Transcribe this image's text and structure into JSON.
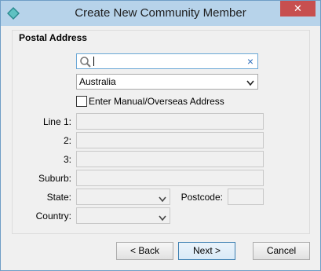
{
  "window": {
    "title": "Create New Community Member"
  },
  "group": {
    "title": "Postal Address"
  },
  "search": {
    "value": "",
    "placeholder": ""
  },
  "country_select": {
    "value": "Australia"
  },
  "manual_address": {
    "label": "Enter Manual/Overseas Address",
    "checked": false
  },
  "labels": {
    "line1": "Line 1:",
    "line2": "2:",
    "line3": "3:",
    "suburb": "Suburb:",
    "state": "State:",
    "postcode": "Postcode:",
    "country": "Country:"
  },
  "buttons": {
    "back": "< Back",
    "next": "Next >",
    "cancel": "Cancel"
  },
  "icons": [
    "app-icon",
    "search-icon",
    "close-icon",
    "chevron-down-icon"
  ],
  "colors": {
    "titlebar": "#b7d3ea",
    "close": "#c74f4f",
    "accent": "#3c7fb1"
  }
}
